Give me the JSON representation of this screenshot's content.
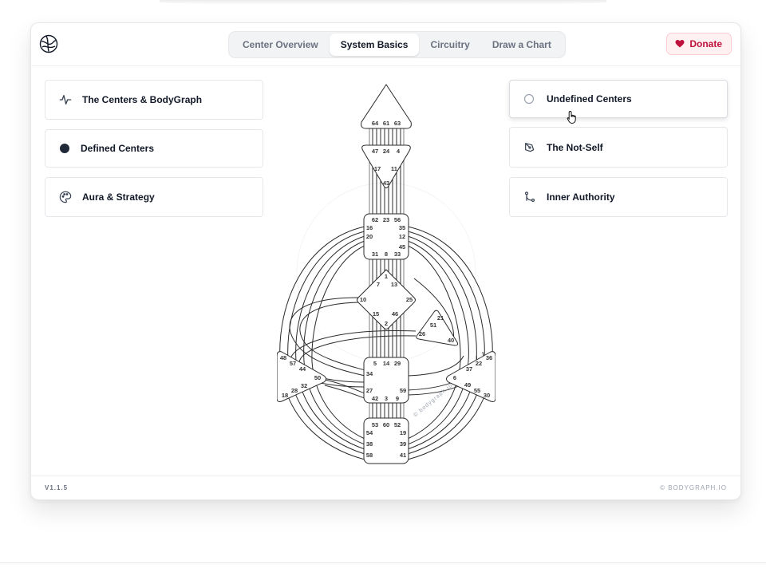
{
  "header": {
    "tabs": [
      {
        "label": "Center Overview",
        "active": false
      },
      {
        "label": "System Basics",
        "active": true
      },
      {
        "label": "Circuitry",
        "active": false
      },
      {
        "label": "Draw a Chart",
        "active": false
      }
    ],
    "donate_label": "Donate"
  },
  "left_items": [
    {
      "label": "The Centers & BodyGraph",
      "icon": "pulse-icon"
    },
    {
      "label": "Defined Centers",
      "icon": "filled-circle-icon"
    },
    {
      "label": "Aura & Strategy",
      "icon": "palette-icon"
    }
  ],
  "right_items": [
    {
      "label": "Undefined Centers",
      "icon": "empty-circle-icon"
    },
    {
      "label": "The Not-Self",
      "icon": "pen-tool-icon"
    },
    {
      "label": "Inner Authority",
      "icon": "git-branch-icon"
    }
  ],
  "bodygraph": {
    "watermark": "© bodygraph.io",
    "head": [
      "64",
      "61",
      "63"
    ],
    "ajna_top": [
      "47",
      "24",
      "4"
    ],
    "ajna_mid": [
      "17",
      "11"
    ],
    "ajna_bottom": "43",
    "throat_top": [
      "62",
      "23",
      "56"
    ],
    "throat_left": [
      "16",
      "20"
    ],
    "throat_right": [
      "35",
      "12",
      "45"
    ],
    "throat_bottom": [
      "31",
      "8",
      "33"
    ],
    "g_top": "1",
    "g_upper": [
      "7",
      "13"
    ],
    "g_sides": [
      "10",
      "25"
    ],
    "g_lower": [
      "15",
      "46"
    ],
    "g_bottom": "2",
    "heart": [
      "21",
      "51",
      "26",
      "40"
    ],
    "spleen": [
      "48",
      "57",
      "44",
      "50",
      "32",
      "28",
      "18"
    ],
    "solar": [
      "36",
      "22",
      "37",
      "6",
      "49",
      "55",
      "30"
    ],
    "sacral_top": [
      "5",
      "14",
      "29"
    ],
    "sacral_left": [
      "34",
      "27"
    ],
    "sacral_right": "59",
    "sacral_bottom": [
      "42",
      "3",
      "9"
    ],
    "root_top": [
      "53",
      "60",
      "52"
    ],
    "root_left": [
      "54",
      "38",
      "58"
    ],
    "root_right": [
      "19",
      "39",
      "41"
    ]
  },
  "footer": {
    "version": "V1.1.5",
    "copyright": "© BODYGRAPH.IO"
  },
  "colors": {
    "accent": "#be123c",
    "donate_bg": "#fff1f2",
    "text": "#111827",
    "muted": "#6b7280"
  }
}
